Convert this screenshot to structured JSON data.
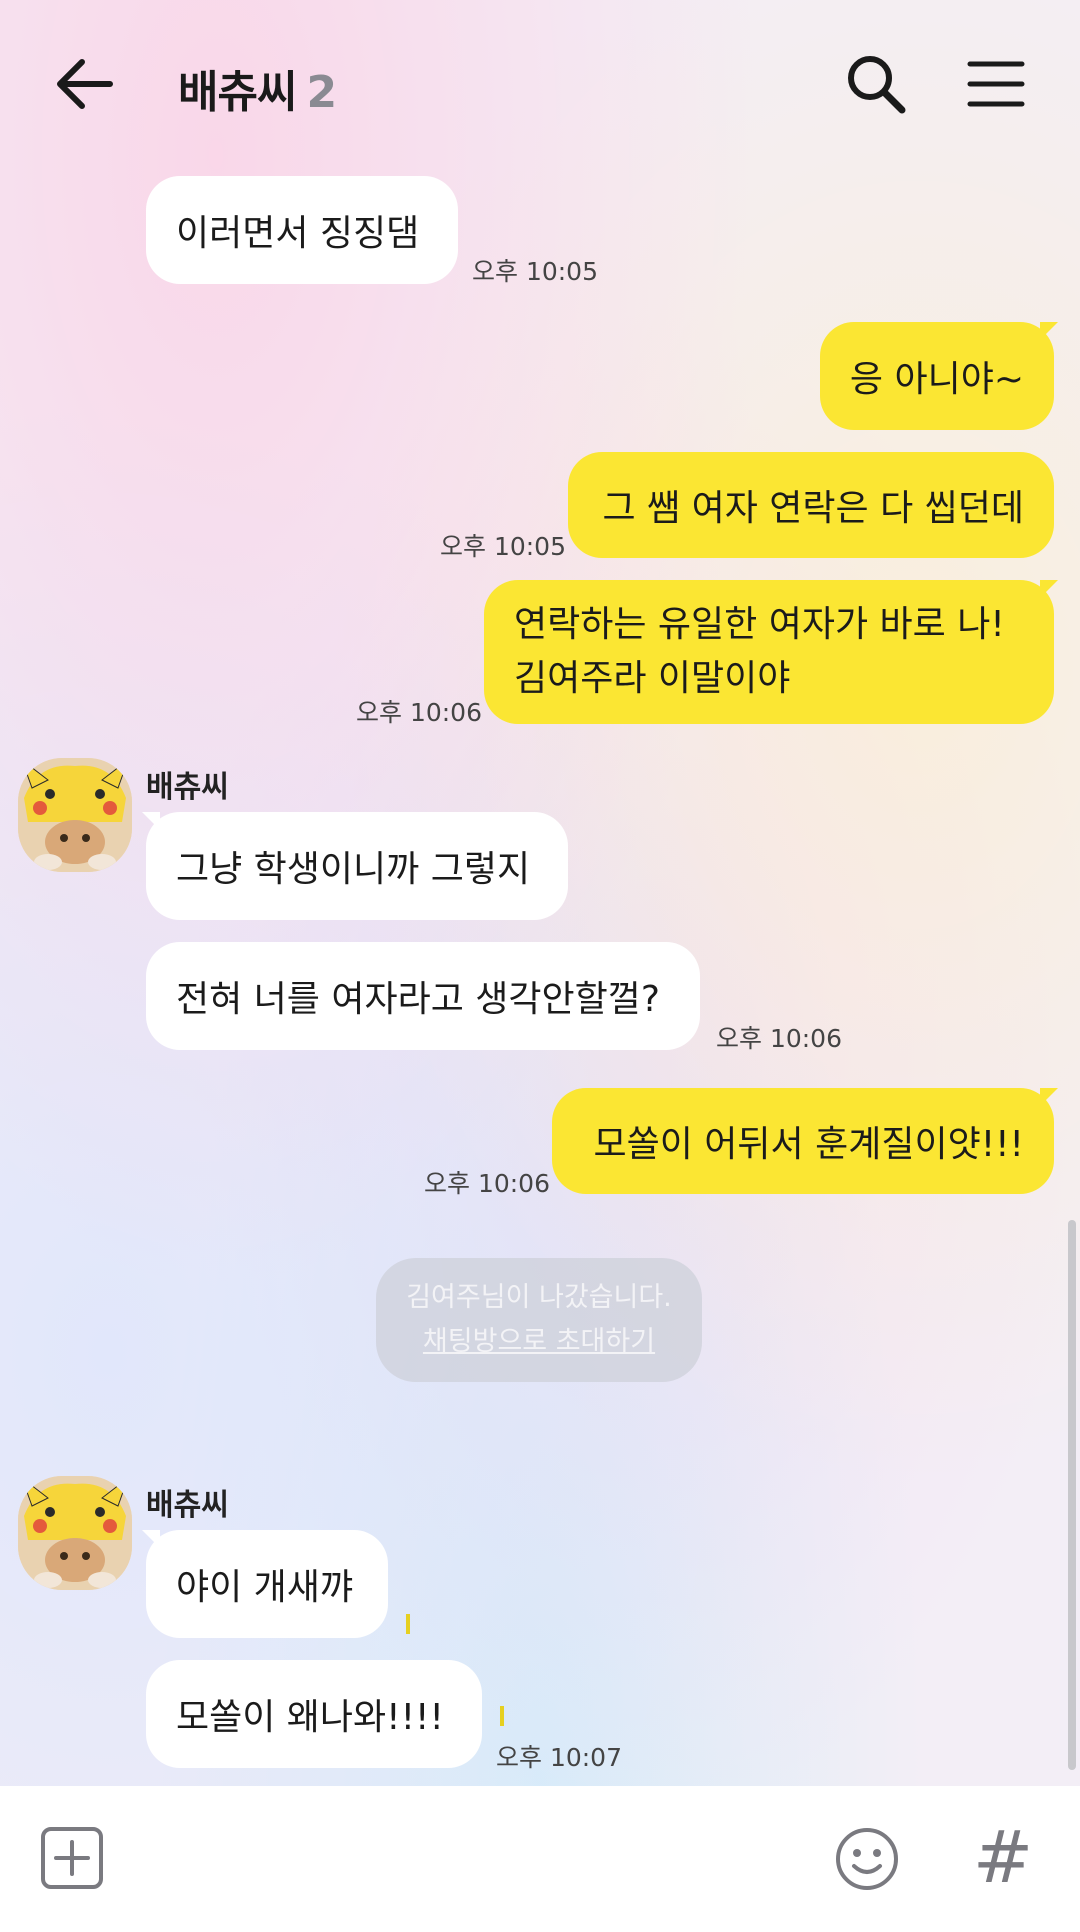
{
  "header": {
    "title": "배츄씨",
    "member_count": "2",
    "back_icon": "arrow-left-icon",
    "search_icon": "search-icon",
    "menu_icon": "hamburger-menu-icon"
  },
  "messages": [
    {
      "text": "이러면서 징징댐",
      "time": "오후 10:05"
    },
    {
      "text": "응 아니야~"
    },
    {
      "text": "그 쌤 여자 연락은 다 씹던데",
      "time": "오후 10:05"
    },
    {
      "line1": "연락하는 유일한 여자가 바로 나!",
      "line2": "김여주라 이말이야",
      "time": "오후 10:06"
    },
    {
      "sender": "배츄씨",
      "text": "그냥 학생이니까 그렇지"
    },
    {
      "text": "전혀 너를 여자라고 생각안할껄?",
      "time": "오후 10:06"
    },
    {
      "text": "모쏠이 어뒤서 훈계질이얏!!!",
      "time": "오후 10:06"
    },
    {
      "sender": "배츄씨",
      "text": "야이 개새꺄"
    },
    {
      "text": "모쏠이 왜나와!!!!",
      "time": "오후 10:07"
    }
  ],
  "notice": {
    "line1": "김여주님이 나갔습니다.",
    "link": "채팅방으로 초대하기"
  },
  "input_bar": {
    "add_icon": "plus-square-icon",
    "emoji_icon": "smiley-icon",
    "hashtag_icon": "hashtag-icon",
    "hashtag_glyph": "#"
  },
  "colors": {
    "outgoing_bubble": "#fbe633",
    "incoming_bubble": "#ffffff"
  }
}
